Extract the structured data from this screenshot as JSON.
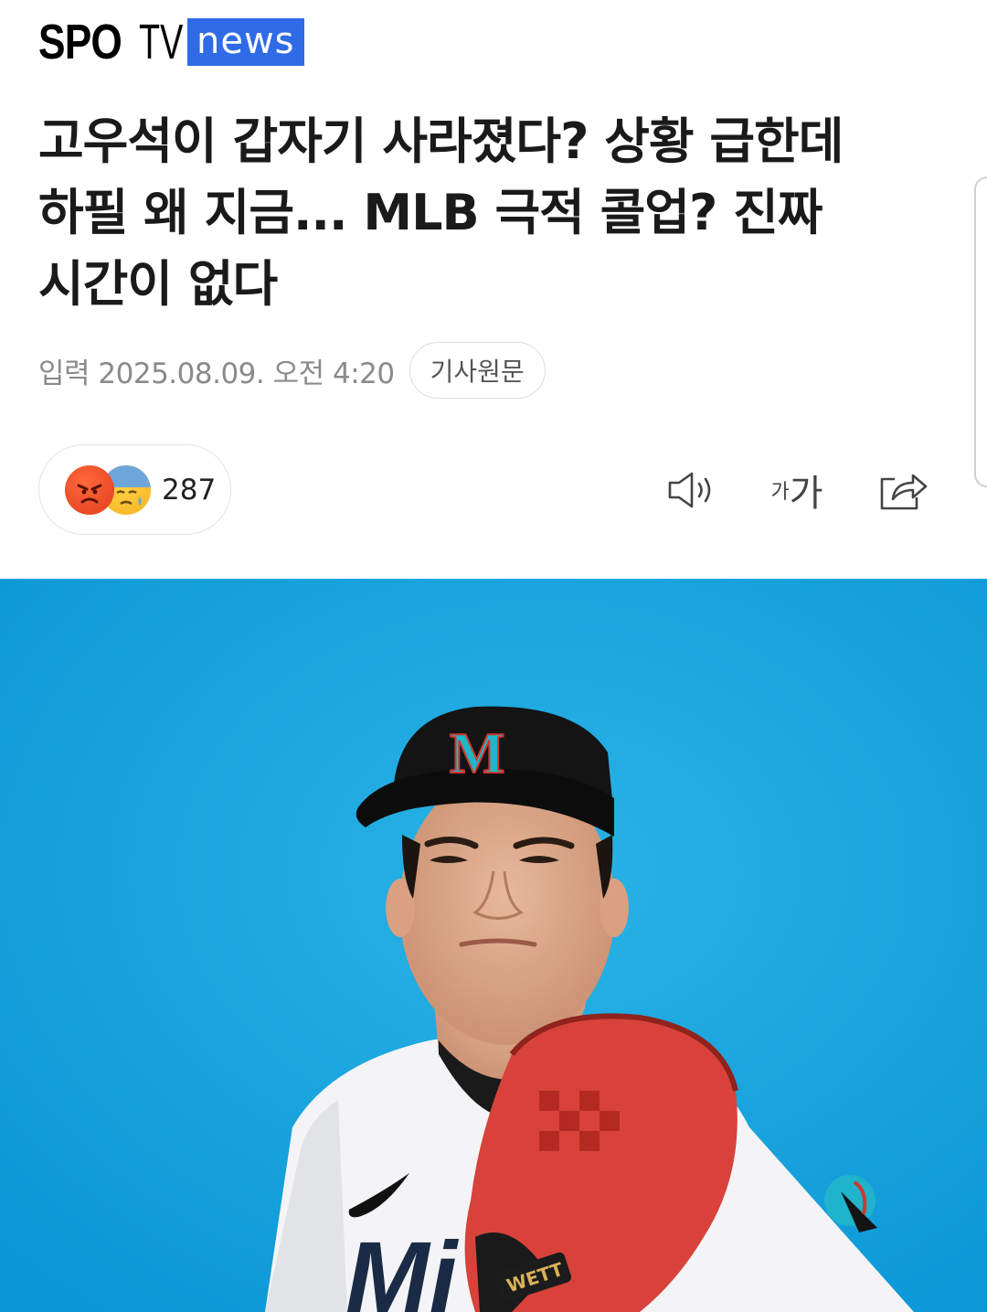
{
  "logo": {
    "spo": "SPO",
    "tv": "TV",
    "news": "news"
  },
  "article": {
    "title": "고우석이 갑자기 사라졌다? 상황 급한데 하필 왜 지금... MLB 극적 콜업? 진짜 시간이 없다",
    "date": "입력 2025.08.09. 오전 4:20",
    "original_button": "기사원문"
  },
  "reactions": {
    "count": "287"
  },
  "tools": {
    "font_small": "가",
    "font_large": "가"
  },
  "photo": {
    "cap_letter": "M",
    "jersey_text": "Mi",
    "glove_brand": "WETT"
  },
  "colors": {
    "news_blue": "#2f6be6",
    "photo_bg": "#1aa5dd",
    "glove_red": "#d8423a"
  }
}
